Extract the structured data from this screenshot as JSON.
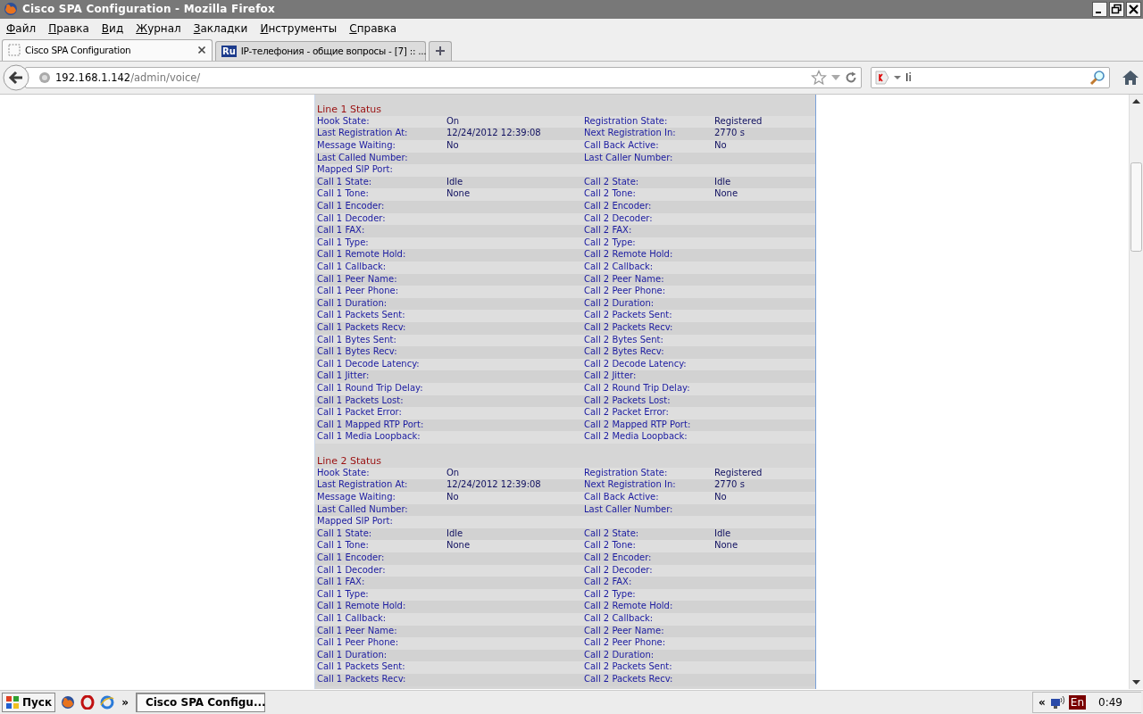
{
  "window": {
    "title": "Cisco SPA Configuration - Mozilla Firefox"
  },
  "menu": [
    "Файл",
    "Правка",
    "Вид",
    "Журнал",
    "Закладки",
    "Инструменты",
    "Справка"
  ],
  "tabs": [
    {
      "label": "Cisco SPA Configuration",
      "selected": true,
      "kind": "blank"
    },
    {
      "label": "IP-телефония - общие вопросы - [7] :: ...",
      "selected": false,
      "kind": "badge",
      "badge": "Ru"
    }
  ],
  "address": {
    "host": "192.168.1.142",
    "path": "/admin/voice/"
  },
  "search": {
    "value": "Ii"
  },
  "sections": [
    {
      "title": "Line 1 Status",
      "rows": [
        {
          "label": "Hook State:",
          "value": "On",
          "label_2": "Registration State:",
          "value_2": "Registered"
        },
        {
          "label": "Last Registration At:",
          "value": "12/24/2012 12:39:08",
          "label_2": "Next Registration In:",
          "value_2": "2770 s"
        },
        {
          "label": "Message Waiting:",
          "value": "No",
          "label_2": "Call Back Active:",
          "value_2": "No"
        },
        {
          "label": "Last Called Number:",
          "label_2": "Last Caller Number:"
        },
        {
          "label": "Mapped SIP Port:"
        },
        {
          "label": "Call 1 State:",
          "value": "Idle",
          "label_2": "Call 2 State:",
          "value_2": "Idle"
        },
        {
          "label": "Call 1 Tone:",
          "value": "None",
          "label_2": "Call 2 Tone:",
          "value_2": "None"
        },
        {
          "label": "Call 1 Encoder:",
          "label_2": "Call 2 Encoder:"
        },
        {
          "label": "Call 1 Decoder:",
          "label_2": "Call 2 Decoder:"
        },
        {
          "label": "Call 1 FAX:",
          "label_2": "Call 2 FAX:"
        },
        {
          "label": "Call 1 Type:",
          "label_2": "Call 2 Type:"
        },
        {
          "label": "Call 1 Remote Hold:",
          "label_2": "Call 2 Remote Hold:"
        },
        {
          "label": "Call 1 Callback:",
          "label_2": "Call 2 Callback:"
        },
        {
          "label": "Call 1 Peer Name:",
          "label_2": "Call 2 Peer Name:"
        },
        {
          "label": "Call 1 Peer Phone:",
          "label_2": "Call 2 Peer Phone:"
        },
        {
          "label": "Call 1 Duration:",
          "label_2": "Call 2 Duration:"
        },
        {
          "label": "Call 1 Packets Sent:",
          "label_2": "Call 2 Packets Sent:"
        },
        {
          "label": "Call 1 Packets Recv:",
          "label_2": "Call 2 Packets Recv:"
        },
        {
          "label": "Call 1 Bytes Sent:",
          "label_2": "Call 2 Bytes Sent:"
        },
        {
          "label": "Call 1 Bytes Recv:",
          "label_2": "Call 2 Bytes Recv:"
        },
        {
          "label": "Call 1 Decode Latency:",
          "label_2": "Call 2 Decode Latency:"
        },
        {
          "label": "Call 1 Jitter:",
          "label_2": "Call 2 Jitter:"
        },
        {
          "label": "Call 1 Round Trip Delay:",
          "label_2": "Call 2 Round Trip Delay:"
        },
        {
          "label": "Call 1 Packets Lost:",
          "label_2": "Call 2 Packets Lost:"
        },
        {
          "label": "Call 1 Packet Error:",
          "label_2": "Call 2 Packet Error:"
        },
        {
          "label": "Call 1 Mapped RTP Port:",
          "label_2": "Call 2 Mapped RTP Port:"
        },
        {
          "label": "Call 1 Media Loopback:",
          "label_2": "Call 2 Media Loopback:"
        }
      ]
    },
    {
      "title": "Line 2 Status",
      "rows": [
        {
          "label": "Hook State:",
          "value": "On",
          "label_2": "Registration State:",
          "value_2": "Registered"
        },
        {
          "label": "Last Registration At:",
          "value": "12/24/2012 12:39:08",
          "label_2": "Next Registration In:",
          "value_2": "2770 s"
        },
        {
          "label": "Message Waiting:",
          "value": "No",
          "label_2": "Call Back Active:",
          "value_2": "No"
        },
        {
          "label": "Last Called Number:",
          "label_2": "Last Caller Number:"
        },
        {
          "label": "Mapped SIP Port:"
        },
        {
          "label": "Call 1 State:",
          "value": "Idle",
          "label_2": "Call 2 State:",
          "value_2": "Idle"
        },
        {
          "label": "Call 1 Tone:",
          "value": "None",
          "label_2": "Call 2 Tone:",
          "value_2": "None"
        },
        {
          "label": "Call 1 Encoder:",
          "label_2": "Call 2 Encoder:"
        },
        {
          "label": "Call 1 Decoder:",
          "label_2": "Call 2 Decoder:"
        },
        {
          "label": "Call 1 FAX:",
          "label_2": "Call 2 FAX:"
        },
        {
          "label": "Call 1 Type:",
          "label_2": "Call 2 Type:"
        },
        {
          "label": "Call 1 Remote Hold:",
          "label_2": "Call 2 Remote Hold:"
        },
        {
          "label": "Call 1 Callback:",
          "label_2": "Call 2 Callback:"
        },
        {
          "label": "Call 1 Peer Name:",
          "label_2": "Call 2 Peer Name:"
        },
        {
          "label": "Call 1 Peer Phone:",
          "label_2": "Call 2 Peer Phone:"
        },
        {
          "label": "Call 1 Duration:",
          "label_2": "Call 2 Duration:"
        },
        {
          "label": "Call 1 Packets Sent:",
          "label_2": "Call 2 Packets Sent:"
        },
        {
          "label": "Call 1 Packets Recv:",
          "label_2": "Call 2 Packets Recv:"
        }
      ]
    }
  ],
  "taskbar": {
    "start": "Пуск",
    "overflow": "»",
    "task": "Cisco SPA Configu...",
    "tray_overflow": "«",
    "language": "En",
    "time": "0:49"
  }
}
